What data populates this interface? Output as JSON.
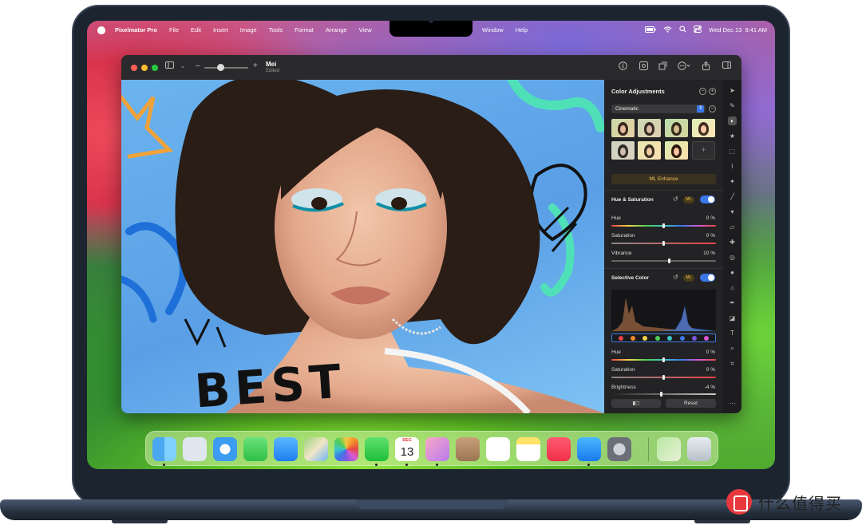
{
  "menubar": {
    "app_name": "Pixelmator Pro",
    "menus_left": [
      "File",
      "Edit",
      "Insert",
      "Image",
      "Tools",
      "Format",
      "Arrange",
      "View"
    ],
    "menus_right": [
      "Window",
      "Help"
    ],
    "clock": "Wed Dec 13  9:41 AM",
    "status_icons": [
      "battery-icon",
      "wifi-icon",
      "search-icon",
      "control-center-icon"
    ]
  },
  "window": {
    "doc_title": "Mei",
    "doc_subtitle": "Edited",
    "canvas_text": "BEST",
    "toolbar_icons": [
      "sidebar-icon",
      "zoom-out-icon",
      "zoom-in-icon",
      "info-icon",
      "arrange-icon",
      "crop-icon",
      "more-icon",
      "share-icon",
      "panel-icon"
    ]
  },
  "panel": {
    "title": "Color Adjustments",
    "preset": "Cinematic",
    "ml_enhance": "ML Enhance",
    "hue_saturation": {
      "title": "Hue & Saturation",
      "ml_badge": "ML",
      "enabled": true,
      "rows": [
        {
          "label": "Hue",
          "value": "0 %",
          "level": 0.5
        },
        {
          "label": "Saturation",
          "value": "0 %",
          "level": 0.5
        },
        {
          "label": "Vibrance",
          "value": "10 %",
          "level": 0.55
        }
      ]
    },
    "selective_color": {
      "title": "Selective Color",
      "ml_badge": "ML",
      "enabled": true,
      "rows": [
        {
          "label": "Hue",
          "value": "0 %",
          "level": 0.5
        },
        {
          "label": "Saturation",
          "value": "0 %",
          "level": 0.5
        },
        {
          "label": "Brightness",
          "value": "-4 %",
          "level": 0.48
        }
      ],
      "swatch_colors": [
        "#e84545",
        "#f08a2c",
        "#f2d64b",
        "#4fcf57",
        "#3fc6c6",
        "#3b78e7",
        "#7a5ae0",
        "#d85ad6"
      ]
    },
    "compare_button": "▮◻",
    "reset_button": "Reset"
  },
  "dock": {
    "apps": [
      "Finder",
      "Launchpad",
      "Safari",
      "Messages",
      "Mail",
      "Maps",
      "Photos",
      "FaceTime",
      "Calendar",
      "Pixelmator Pro",
      "Contacts",
      "Reminders",
      "Notes",
      "Music",
      "App Store",
      "System Settings",
      "Preview",
      "Trash"
    ],
    "calendar_month": "DEC",
    "calendar_day": "13"
  },
  "watermark": {
    "text": "什么值得买"
  },
  "colors": {
    "accent": "#3b78e7",
    "ml_gold": "#f0c35a",
    "panel_bg": "#232325"
  }
}
